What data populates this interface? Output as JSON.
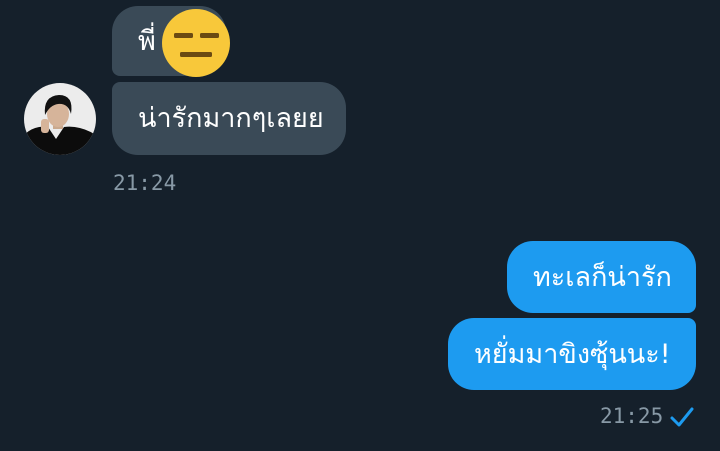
{
  "conversation": {
    "incoming": {
      "messages": [
        {
          "text": "พี่"
        },
        {
          "text": "น่ารักมากๆเลยย"
        }
      ],
      "time": "21:24",
      "emoji_icon": "expressionless-face-icon",
      "avatar": "user-avatar"
    },
    "outgoing": {
      "messages": [
        {
          "text": "ทะเลก็น่ารัก"
        },
        {
          "text": "หยั่มมาขิงซุ้นนะ!"
        }
      ],
      "time": "21:25",
      "status_icon": "sent-check-icon"
    }
  },
  "colors": {
    "background": "#15202b",
    "incoming_bubble": "#3a4a57",
    "outgoing_bubble": "#1d9bf0",
    "timestamp": "#8899a6",
    "emoji": "#f8c83a"
  }
}
